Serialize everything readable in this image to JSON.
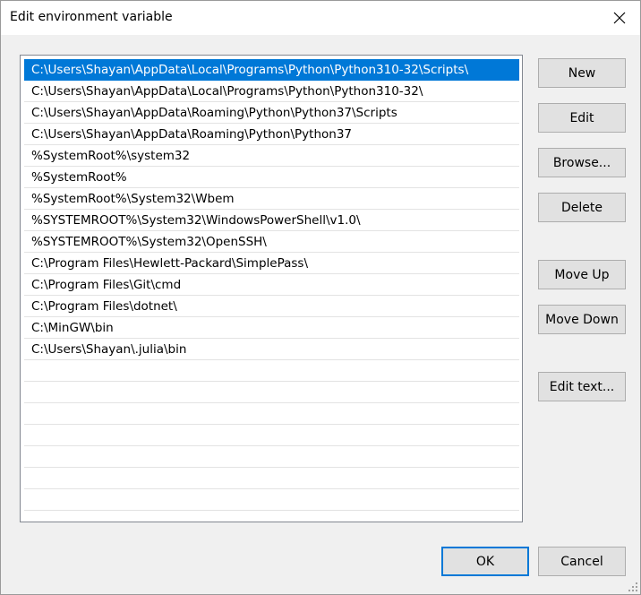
{
  "window": {
    "title": "Edit environment variable"
  },
  "paths": [
    "C:\\Users\\Shayan\\AppData\\Local\\Programs\\Python\\Python310-32\\Scripts\\",
    "C:\\Users\\Shayan\\AppData\\Local\\Programs\\Python\\Python310-32\\",
    "C:\\Users\\Shayan\\AppData\\Roaming\\Python\\Python37\\Scripts",
    "C:\\Users\\Shayan\\AppData\\Roaming\\Python\\Python37",
    "%SystemRoot%\\system32",
    "%SystemRoot%",
    "%SystemRoot%\\System32\\Wbem",
    "%SYSTEMROOT%\\System32\\WindowsPowerShell\\v1.0\\",
    "%SYSTEMROOT%\\System32\\OpenSSH\\",
    "C:\\Program Files\\Hewlett-Packard\\SimplePass\\",
    "C:\\Program Files\\Git\\cmd",
    "C:\\Program Files\\dotnet\\",
    "C:\\MinGW\\bin",
    "C:\\Users\\Shayan\\.julia\\bin"
  ],
  "selected_index": 0,
  "buttons": {
    "new": "New",
    "edit": "Edit",
    "browse": "Browse...",
    "delete": "Delete",
    "move_up": "Move Up",
    "move_down": "Move Down",
    "edit_text": "Edit text...",
    "ok": "OK",
    "cancel": "Cancel"
  },
  "colors": {
    "selection": "#0078d7",
    "button_face": "#e1e1e1",
    "dialog_bg": "#f0f0f0"
  }
}
